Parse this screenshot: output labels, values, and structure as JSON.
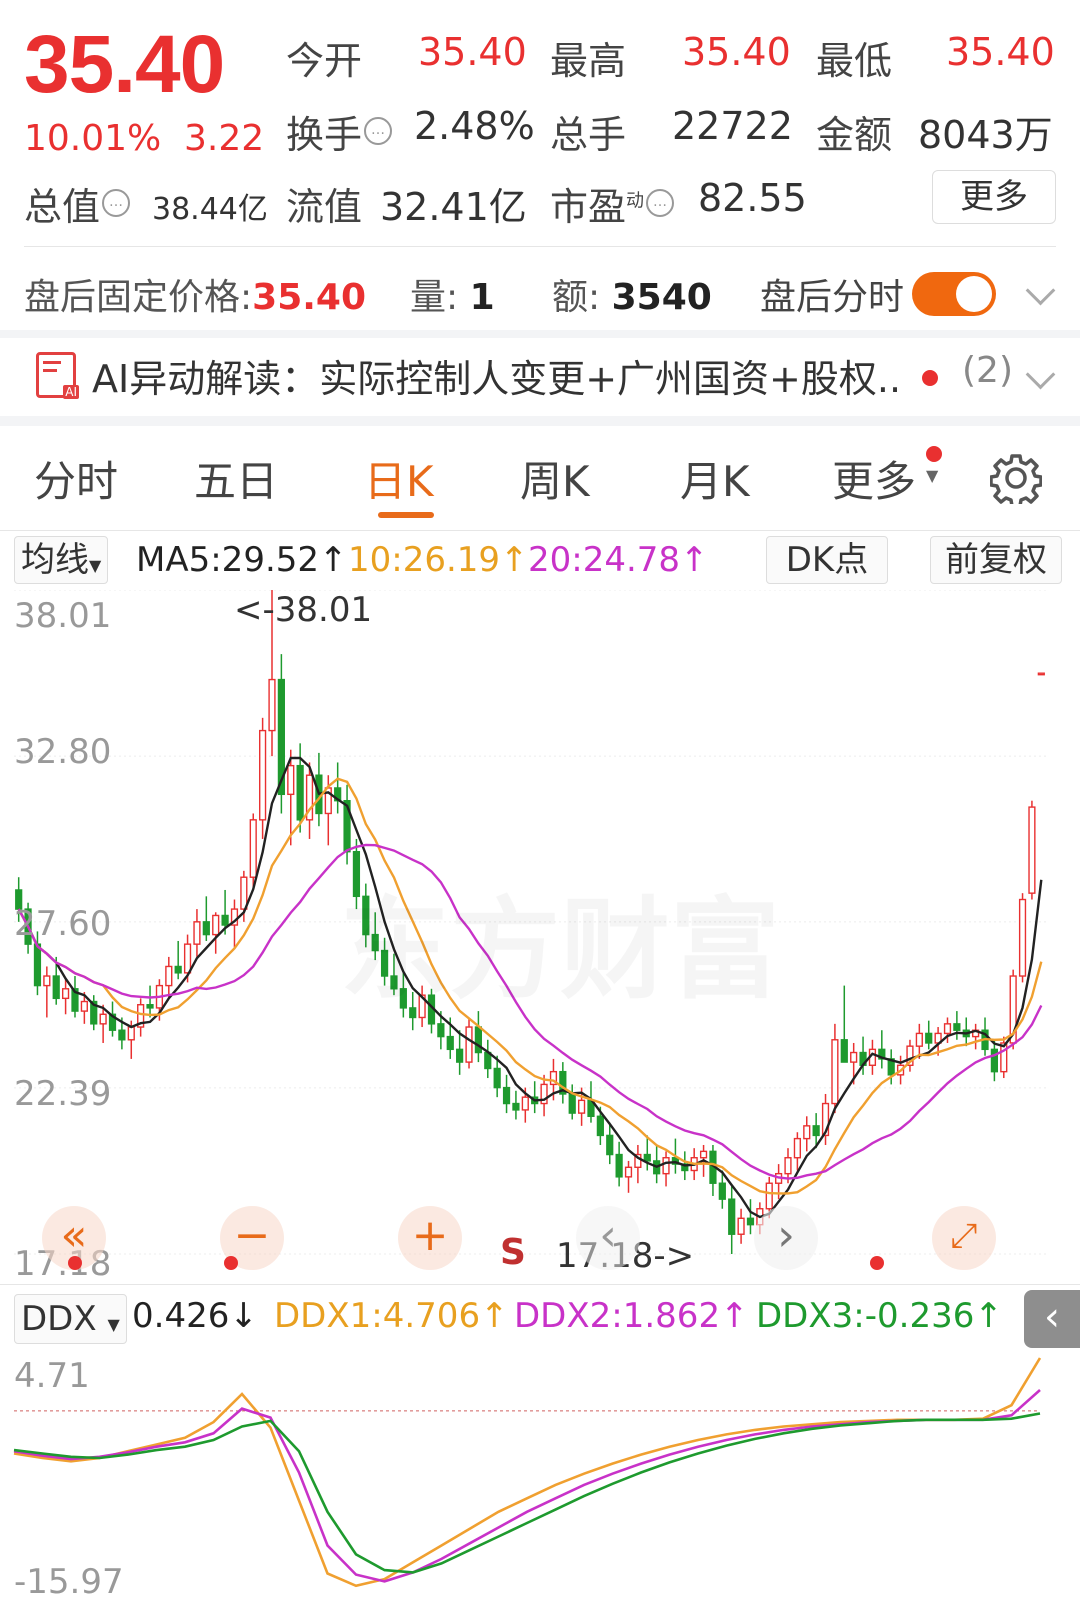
{
  "quote": {
    "price": "35.40",
    "change_pct": "10.01%",
    "change_amt": "3.22",
    "open_label": "今开",
    "open": "35.40",
    "high_label": "最高",
    "high": "35.40",
    "low_label": "最低",
    "low": "35.40",
    "turnover_label": "换手",
    "turnover": "2.48%",
    "volume_label": "总手",
    "volume": "22722",
    "amount_label": "金额",
    "amount": "8043万",
    "mcap_label": "总值",
    "mcap": "38.44亿",
    "float_label": "流值",
    "float_cap": "32.41亿",
    "pe_label": "市盈",
    "pe_sup": "动",
    "pe": "82.55",
    "more_label": "更多"
  },
  "after_hours": {
    "price_label": "盘后固定价格:",
    "price": "35.40",
    "vol_label": "量:",
    "vol": "1",
    "amt_label": "额:",
    "amt": "3540",
    "toggle_label": "盘后分时",
    "toggle_on": true
  },
  "ai_banner": {
    "icon": "ai-report-icon",
    "text": "AI异动解读：实际控制人变更+广州国资+股权...",
    "count": "(2)"
  },
  "tabs": [
    "分时",
    "五日",
    "日K",
    "周K",
    "月K",
    "更多"
  ],
  "active_tab": "日K",
  "kline_header": {
    "indicator": "均线",
    "ma5": "MA5:29.52↑",
    "ma10": "10:26.19↑",
    "ma20": "20:24.78↑",
    "dk_label": "DK点",
    "adjust_label": "前复权"
  },
  "price_axis": [
    "38.01",
    "32.80",
    "27.60",
    "22.39",
    "17.18"
  ],
  "max_marker": "<-38.01",
  "min_marker": "17.18->",
  "s_marker": "S",
  "ddx_header": {
    "indicator": "DDX",
    "ddx": "0.426↓",
    "ddx1": "DDX1:4.706↑",
    "ddx2": "DDX2:1.862↑",
    "ddx3": "DDX3:-0.236↑"
  },
  "ddx_axis": [
    "4.71",
    "-15.97"
  ],
  "watermark": "东方财富",
  "colors": {
    "up": "#e93030",
    "down": "#1e9a2e",
    "ma5": "#222222",
    "ma10": "#f0a030",
    "ma20": "#c832c8",
    "accent": "#e86b1a"
  },
  "chart_data": [
    {
      "type": "candlestick",
      "title": "日K",
      "ylim": [
        17.18,
        38.01
      ],
      "ohlc": [
        [
          28.6,
          29.0,
          27.6,
          28.0
        ],
        [
          28.0,
          28.2,
          26.6,
          26.9
        ],
        [
          26.9,
          27.3,
          25.3,
          25.6
        ],
        [
          25.6,
          26.2,
          24.6,
          25.9
        ],
        [
          25.9,
          26.5,
          25.0,
          25.2
        ],
        [
          25.2,
          25.8,
          24.7,
          25.5
        ],
        [
          25.5,
          25.9,
          24.6,
          24.8
        ],
        [
          24.8,
          25.4,
          24.4,
          25.1
        ],
        [
          25.1,
          25.3,
          24.2,
          24.4
        ],
        [
          24.4,
          25.0,
          23.8,
          24.7
        ],
        [
          24.7,
          25.1,
          24.0,
          24.2
        ],
        [
          24.2,
          24.6,
          23.6,
          23.9
        ],
        [
          23.9,
          24.5,
          23.3,
          24.3
        ],
        [
          24.3,
          25.2,
          24.0,
          25.0
        ],
        [
          25.0,
          25.6,
          24.6,
          24.9
        ],
        [
          24.9,
          25.8,
          24.5,
          25.6
        ],
        [
          25.6,
          26.5,
          25.2,
          26.2
        ],
        [
          26.2,
          27.0,
          25.8,
          26.0
        ],
        [
          26.0,
          27.2,
          25.7,
          26.9
        ],
        [
          26.9,
          28.0,
          26.5,
          27.6
        ],
        [
          27.6,
          28.4,
          27.0,
          27.2
        ],
        [
          27.2,
          27.9,
          26.6,
          27.8
        ],
        [
          27.8,
          28.6,
          27.2,
          27.5
        ],
        [
          27.5,
          28.3,
          26.8,
          28.0
        ],
        [
          28.0,
          29.2,
          27.6,
          29.0
        ],
        [
          29.0,
          31.0,
          28.6,
          30.8
        ],
        [
          30.8,
          34.0,
          30.2,
          33.6
        ],
        [
          33.6,
          38.01,
          32.8,
          35.2
        ],
        [
          35.2,
          36.0,
          31.0,
          31.6
        ],
        [
          31.6,
          33.0,
          30.0,
          32.5
        ],
        [
          32.5,
          33.2,
          30.4,
          30.8
        ],
        [
          30.8,
          32.6,
          30.2,
          32.2
        ],
        [
          32.2,
          32.9,
          30.6,
          31.0
        ],
        [
          31.0,
          32.2,
          30.0,
          31.8
        ],
        [
          31.8,
          32.6,
          31.0,
          31.4
        ],
        [
          31.4,
          31.9,
          29.4,
          29.8
        ],
        [
          29.8,
          30.2,
          28.0,
          28.4
        ],
        [
          28.4,
          28.8,
          26.8,
          27.2
        ],
        [
          27.2,
          27.9,
          26.4,
          26.7
        ],
        [
          26.7,
          27.1,
          25.6,
          25.9
        ],
        [
          25.9,
          26.6,
          25.3,
          25.5
        ],
        [
          25.5,
          26.0,
          24.6,
          24.9
        ],
        [
          24.9,
          25.4,
          24.2,
          24.6
        ],
        [
          24.6,
          25.6,
          24.3,
          25.3
        ],
        [
          25.3,
          25.5,
          24.1,
          24.4
        ],
        [
          24.4,
          24.8,
          23.6,
          24.0
        ],
        [
          24.0,
          24.6,
          23.3,
          23.6
        ],
        [
          23.6,
          24.2,
          22.8,
          23.2
        ],
        [
          23.2,
          24.6,
          23.0,
          24.3
        ],
        [
          24.3,
          24.8,
          23.2,
          23.5
        ],
        [
          23.5,
          23.9,
          22.7,
          23.0
        ],
        [
          23.0,
          23.4,
          22.1,
          22.4
        ],
        [
          22.4,
          22.8,
          21.6,
          21.9
        ],
        [
          21.9,
          22.3,
          21.4,
          21.7
        ],
        [
          21.7,
          22.4,
          21.3,
          22.1
        ],
        [
          22.1,
          22.6,
          21.6,
          21.9
        ],
        [
          21.9,
          22.8,
          21.5,
          22.5
        ],
        [
          22.5,
          23.3,
          22.0,
          22.9
        ],
        [
          22.9,
          23.2,
          21.9,
          22.2
        ],
        [
          22.2,
          22.5,
          21.4,
          21.6
        ],
        [
          21.6,
          22.4,
          21.2,
          22.0
        ],
        [
          22.0,
          22.6,
          21.3,
          21.5
        ],
        [
          21.5,
          21.8,
          20.6,
          20.9
        ],
        [
          20.9,
          21.3,
          20.0,
          20.3
        ],
        [
          20.3,
          20.7,
          19.3,
          19.6
        ],
        [
          19.6,
          20.1,
          19.1,
          19.9
        ],
        [
          19.9,
          20.6,
          19.4,
          20.3
        ],
        [
          20.3,
          20.9,
          19.8,
          20.1
        ],
        [
          20.1,
          20.6,
          19.4,
          19.7
        ],
        [
          19.7,
          20.4,
          19.3,
          20.2
        ],
        [
          20.2,
          20.8,
          19.7,
          20.0
        ],
        [
          20.0,
          20.4,
          19.5,
          19.8
        ],
        [
          19.8,
          20.5,
          19.5,
          20.2
        ],
        [
          20.2,
          20.6,
          19.6,
          20.4
        ],
        [
          20.4,
          20.6,
          19.0,
          19.4
        ],
        [
          19.4,
          19.8,
          18.6,
          18.9
        ],
        [
          18.9,
          19.3,
          17.18,
          17.8
        ],
        [
          17.8,
          18.6,
          17.5,
          18.3
        ],
        [
          18.3,
          18.9,
          17.8,
          18.1
        ],
        [
          18.1,
          18.8,
          17.8,
          18.6
        ],
        [
          18.6,
          19.6,
          18.3,
          19.4
        ],
        [
          19.4,
          20.0,
          18.9,
          19.7
        ],
        [
          19.7,
          20.5,
          19.4,
          20.2
        ],
        [
          20.2,
          21.0,
          19.8,
          20.8
        ],
        [
          20.8,
          21.5,
          20.4,
          21.2
        ],
        [
          21.2,
          21.6,
          20.5,
          20.9
        ],
        [
          20.9,
          22.2,
          20.6,
          21.9
        ],
        [
          21.9,
          24.4,
          21.6,
          23.9
        ],
        [
          23.9,
          25.6,
          23.4,
          23.2
        ],
        [
          23.2,
          23.8,
          22.5,
          23.5
        ],
        [
          23.5,
          24.0,
          22.8,
          23.1
        ],
        [
          23.1,
          23.9,
          22.8,
          23.6
        ],
        [
          23.6,
          24.2,
          23.0,
          23.3
        ],
        [
          23.3,
          23.6,
          22.5,
          22.8
        ],
        [
          22.8,
          23.4,
          22.5,
          23.1
        ],
        [
          23.1,
          23.9,
          22.9,
          23.7
        ],
        [
          23.7,
          24.4,
          23.3,
          24.1
        ],
        [
          24.1,
          24.5,
          23.6,
          23.8
        ],
        [
          23.8,
          24.3,
          23.4,
          24.1
        ],
        [
          24.1,
          24.6,
          23.8,
          24.4
        ],
        [
          24.4,
          24.8,
          23.9,
          24.2
        ],
        [
          24.2,
          24.6,
          23.7,
          24.0
        ],
        [
          24.0,
          24.4,
          23.6,
          24.2
        ],
        [
          24.2,
          24.6,
          23.4,
          23.6
        ],
        [
          23.6,
          23.9,
          22.6,
          22.9
        ],
        [
          22.9,
          24.0,
          22.7,
          23.8
        ],
        [
          23.8,
          26.1,
          23.6,
          25.9
        ],
        [
          25.9,
          28.5,
          25.7,
          28.3
        ],
        [
          28.5,
          31.4,
          28.3,
          31.2
        ],
        [
          35.4,
          35.4,
          35.4,
          35.4
        ]
      ],
      "ma5_end": 29.52,
      "ma10_end": 26.19,
      "ma20_end": 24.78
    },
    {
      "type": "line",
      "title": "DDX",
      "ylim": [
        -15.97,
        4.71
      ],
      "series": [
        {
          "name": "DDX1",
          "values": [
            -3.8,
            -4.2,
            -4.5,
            -4.2,
            -3.6,
            -3.0,
            -2.4,
            -1.0,
            1.5,
            -1.5,
            -8.0,
            -14.5,
            -15.6,
            -15.0,
            -13.5,
            -12.0,
            -10.5,
            -9.0,
            -7.8,
            -6.6,
            -5.6,
            -4.7,
            -3.9,
            -3.2,
            -2.6,
            -2.1,
            -1.7,
            -1.4,
            -1.2,
            -1.0,
            -0.9,
            -0.8,
            -0.8,
            -0.8,
            -0.7,
            0.5,
            4.706
          ]
        },
        {
          "name": "DDX2",
          "values": [
            -3.6,
            -4.0,
            -4.3,
            -4.1,
            -3.7,
            -3.2,
            -2.8,
            -2.0,
            0.2,
            -0.6,
            -5.5,
            -12.0,
            -14.6,
            -15.2,
            -14.4,
            -13.2,
            -11.8,
            -10.4,
            -9.0,
            -7.8,
            -6.6,
            -5.6,
            -4.7,
            -3.9,
            -3.2,
            -2.6,
            -2.1,
            -1.7,
            -1.4,
            -1.2,
            -1.0,
            -0.9,
            -0.8,
            -0.8,
            -0.8,
            -0.4,
            1.862
          ]
        },
        {
          "name": "DDX3",
          "values": [
            -3.5,
            -3.8,
            -4.1,
            -4.2,
            -3.9,
            -3.5,
            -3.2,
            -2.6,
            -1.4,
            -0.9,
            -3.6,
            -9.0,
            -12.8,
            -14.2,
            -14.4,
            -13.6,
            -12.4,
            -11.2,
            -10.0,
            -8.8,
            -7.6,
            -6.5,
            -5.5,
            -4.6,
            -3.8,
            -3.1,
            -2.5,
            -2.0,
            -1.6,
            -1.3,
            -1.1,
            -0.9,
            -0.8,
            -0.8,
            -0.8,
            -0.7,
            -0.236
          ]
        }
      ],
      "ddx_value": 0.426
    }
  ]
}
